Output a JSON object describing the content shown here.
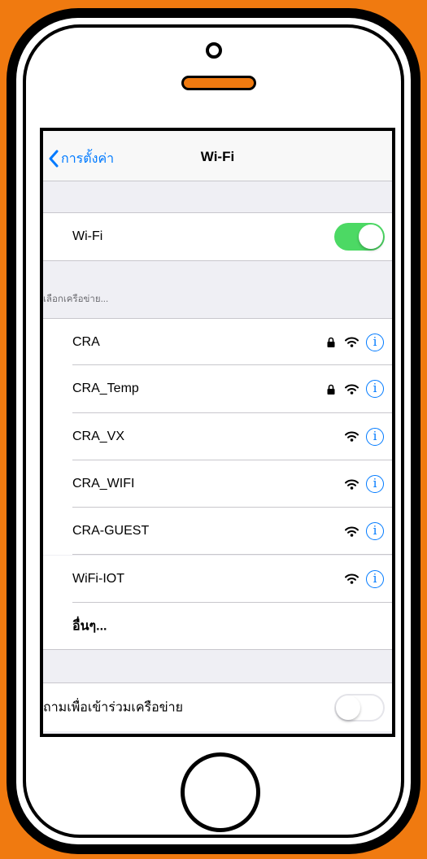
{
  "navbar": {
    "back_label": "การตั้งค่า",
    "title": "Wi-Fi"
  },
  "wifi_row": {
    "label": "Wi-Fi",
    "toggle_on": true
  },
  "networks_section": {
    "header": "เลือกเครือข่าย...",
    "networks": [
      {
        "name": "CRA",
        "locked": true,
        "info_glyph": "i"
      },
      {
        "name": "CRA_Temp",
        "locked": true,
        "info_glyph": "i"
      },
      {
        "name": "CRA_VX",
        "locked": false,
        "info_glyph": "i"
      },
      {
        "name": "CRA_WIFI",
        "locked": false,
        "info_glyph": "i"
      },
      {
        "name": "CRA-GUEST",
        "locked": false,
        "info_glyph": "i"
      },
      {
        "name": "WiFi-IOT",
        "locked": false,
        "info_glyph": "i"
      }
    ],
    "other_label": "อื่นๆ..."
  },
  "ask_join_row": {
    "label": "ถามเพื่อเข้าร่วมเครือข่าย",
    "toggle_on": false
  },
  "colors": {
    "background": "#f07a10",
    "accent": "#007aff",
    "toggle_on": "#4cd964"
  },
  "icons": [
    "chevron-left-icon",
    "lock-icon",
    "wifi-icon",
    "info-icon"
  ]
}
